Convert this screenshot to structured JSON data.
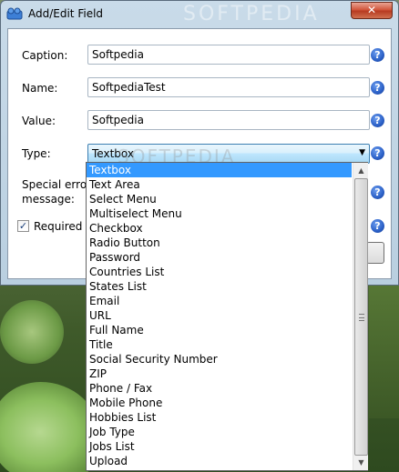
{
  "window": {
    "title": "Add/Edit Field",
    "close_label": "✕",
    "watermark": "SOFTPEDIA"
  },
  "form": {
    "caption": {
      "label": "Caption:",
      "value": "Softpedia"
    },
    "name": {
      "label": "Name:",
      "value": "SoftpediaTest"
    },
    "value": {
      "label": "Value:",
      "value": "Softpedia"
    },
    "type": {
      "label": "Type:",
      "value": "Textbox"
    },
    "error": {
      "label_line1": "Special error",
      "label_line2": "message:"
    },
    "required": {
      "label": "Required fi",
      "checked": true
    }
  },
  "help_glyph": "?",
  "icons": {
    "title": "app-window-icon",
    "help": "help-icon",
    "dropdown": "chevron-down-icon"
  },
  "dropdown": {
    "selected_index": 0,
    "items": [
      "Textbox",
      "Text Area",
      "Select Menu",
      "Multiselect Menu",
      "Checkbox",
      "Radio Button",
      "Password",
      "Countries List",
      "States List",
      "Email",
      "URL",
      "Full Name",
      "Title",
      "Social Security Number",
      "ZIP",
      "Phone / Fax",
      "Mobile Phone",
      "Hobbies List",
      "Job Type",
      "Jobs List",
      "Upload"
    ]
  },
  "colors": {
    "selection": "#3399ff",
    "help_blue": "#2a5fc6",
    "close_red": "#c7492f"
  }
}
